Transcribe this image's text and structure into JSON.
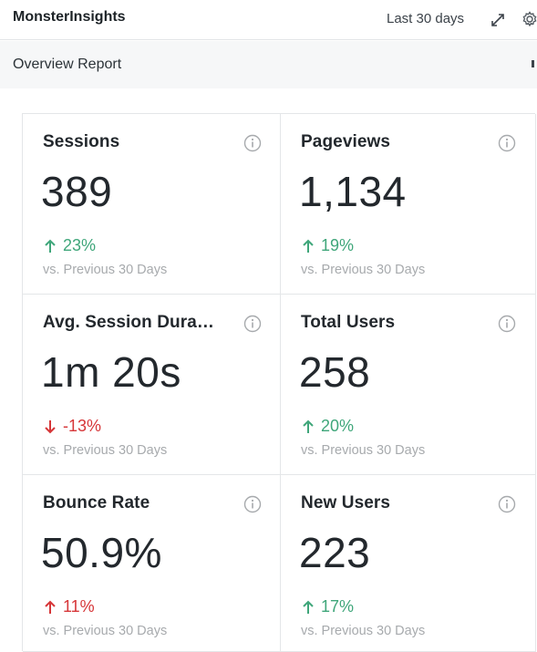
{
  "header": {
    "title": "MonsterInsights",
    "period": "Last 30 days",
    "expand_icon": "expand-icon",
    "settings_icon": "gear-icon"
  },
  "report": {
    "label": "Overview Report"
  },
  "colors": {
    "up": "#3fa67a",
    "down": "#d63638",
    "muted": "#a7aaad"
  },
  "cards": [
    {
      "title": "Sessions",
      "value": "389",
      "change": "23%",
      "direction": "up",
      "compare": "vs. Previous 30 Days"
    },
    {
      "title": "Pageviews",
      "value": "1,134",
      "change": "19%",
      "direction": "up",
      "compare": "vs. Previous 30 Days"
    },
    {
      "title": "Avg. Session Dura…",
      "value": "1m 20s",
      "change": "-13%",
      "direction": "down",
      "compare": "vs. Previous 30 Days"
    },
    {
      "title": "Total Users",
      "value": "258",
      "change": "20%",
      "direction": "up",
      "compare": "vs. Previous 30 Days"
    },
    {
      "title": "Bounce Rate",
      "value": "50.9%",
      "change": "11%",
      "direction": "up-bad",
      "compare": "vs. Previous 30 Days"
    },
    {
      "title": "New Users",
      "value": "223",
      "change": "17%",
      "direction": "up",
      "compare": "vs. Previous 30 Days"
    }
  ]
}
